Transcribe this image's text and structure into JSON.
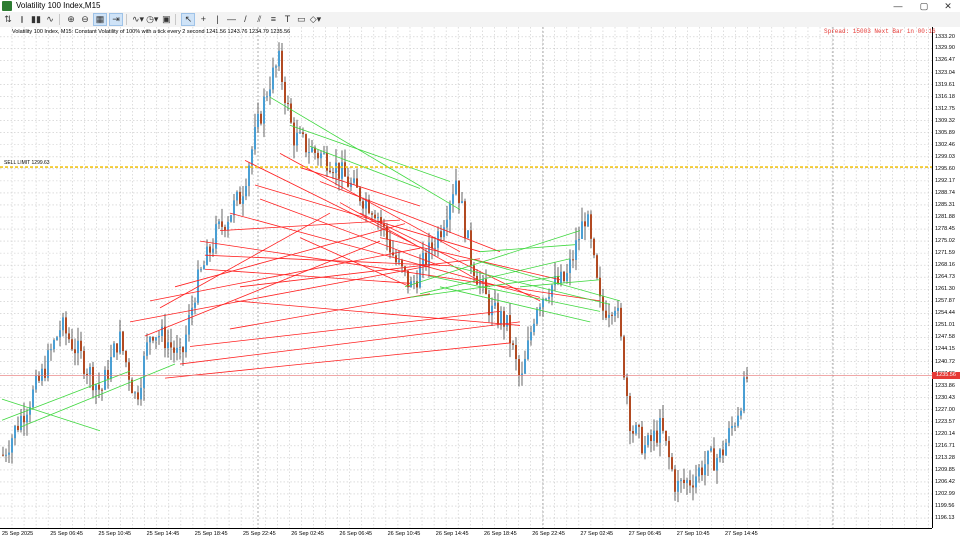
{
  "window": {
    "title": "Volatility 100 Index,M15",
    "minimize": "—",
    "maximize": "▢",
    "close": "✕"
  },
  "toolbar": {
    "items": [
      {
        "name": "new-chart-icon",
        "glyph": "⇅"
      },
      {
        "name": "bar-chart-icon",
        "glyph": "⫾"
      },
      {
        "name": "candle-chart-icon",
        "glyph": "▮▮"
      },
      {
        "name": "line-chart-icon",
        "glyph": "∿"
      },
      {
        "name": "zoom-in-icon",
        "glyph": "⊕"
      },
      {
        "name": "zoom-out-icon",
        "glyph": "⊖"
      },
      {
        "name": "grid-icon",
        "glyph": "▦",
        "active": true
      },
      {
        "name": "autoscroll-icon",
        "glyph": "⇥",
        "active": true
      },
      {
        "name": "indicators-icon",
        "glyph": "∿▾"
      },
      {
        "name": "periods-icon",
        "glyph": "◷▾"
      },
      {
        "name": "templates-icon",
        "glyph": "▣"
      },
      {
        "name": "cursor-icon",
        "glyph": "↖",
        "active": true
      },
      {
        "name": "crosshair-icon",
        "glyph": "+"
      },
      {
        "name": "vertical-line-icon",
        "glyph": "|"
      },
      {
        "name": "horizontal-line-icon",
        "glyph": "—"
      },
      {
        "name": "trend-line-icon",
        "glyph": "/"
      },
      {
        "name": "channel-icon",
        "glyph": "⫽"
      },
      {
        "name": "fibonacci-icon",
        "glyph": "≡"
      },
      {
        "name": "text-icon",
        "glyph": "T"
      },
      {
        "name": "label-icon",
        "glyph": "▭"
      },
      {
        "name": "shapes-icon",
        "glyph": "◇▾"
      }
    ]
  },
  "chart": {
    "info": "Volatility 100 Index, M15: Constant Volatility of 100% with a tick every 2 second 1241.56 1243.76 1234.79 1235.56",
    "spread": "Spread: 15003 Next Bar in 00:16",
    "level_label": "SELL LIMIT 1299.63",
    "level_price": 1296.1,
    "current_price": "1235.56",
    "current_value": 1236.8,
    "y_range": [
      1193.3,
      1336.0
    ],
    "y_ticks": [
      "1333.20",
      "1329.90",
      "1326.47",
      "1323.04",
      "1319.61",
      "1316.18",
      "1312.75",
      "1309.32",
      "1305.89",
      "1302.46",
      "1299.03",
      "1295.60",
      "1292.17",
      "1288.74",
      "1285.31",
      "1281.88",
      "1278.45",
      "1275.02",
      "1271.59",
      "1268.16",
      "1264.73",
      "1261.30",
      "1257.87",
      "1254.44",
      "1251.01",
      "1247.58",
      "1244.15",
      "1240.72",
      "1237.29",
      "1233.86",
      "1230.43",
      "1227.00",
      "1223.57",
      "1220.14",
      "1216.71",
      "1213.28",
      "1209.85",
      "1206.42",
      "1202.99",
      "1199.56",
      "1196.13"
    ],
    "x_ticks": [
      "25 Sep 2025",
      "25 Sep 06:45",
      "25 Sep 10:45",
      "25 Sep 14:45",
      "25 Sep 18:45",
      "25 Sep 22:45",
      "26 Sep 02:45",
      "26 Sep 06:45",
      "26 Sep 10:45",
      "26 Sep 14:45",
      "26 Sep 18:45",
      "26 Sep 22:45",
      "27 Sep 02:45",
      "27 Sep 06:45",
      "27 Sep 10:45",
      "27 Sep 14:45"
    ],
    "colors": {
      "bull": "#4a9fd4",
      "bear": "#b24a22",
      "grid": "#c8c8c8",
      "sell_line": "#ff2020",
      "buy_line": "#3fd83f",
      "level": "#f0c419"
    }
  }
}
